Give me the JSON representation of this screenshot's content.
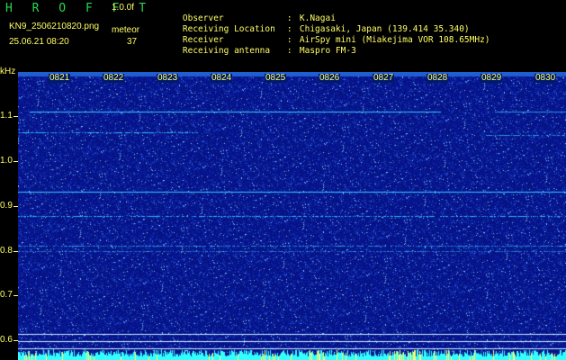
{
  "header": {
    "logo": "H R O F F T",
    "version": "1.0.0f",
    "filename": "KN9_2506210820.png",
    "datetime": "25.06.21 08:20",
    "counter_label": "meteor",
    "counter_value": "37"
  },
  "meta": [
    {
      "key": "Observer",
      "sep": ":",
      "value": "K.Nagai"
    },
    {
      "key": "Receiving Location",
      "sep": ":",
      "value": "Chigasaki, Japan (139.414 35.340)"
    },
    {
      "key": "Receiver",
      "sep": ":",
      "value": "AirSpy mini (Miakejima VOR 108.65MHz)"
    },
    {
      "key": "Receiving antenna",
      "sep": ":",
      "value": "Maspro FM-3"
    }
  ],
  "axis": {
    "unit_label": "kHz",
    "y_ticks": [
      "1.1",
      "1.0",
      "0.9",
      "0.8",
      "0.7",
      "0.6"
    ],
    "time_ticks": [
      "0821",
      "0822",
      "0823",
      "0824",
      "0825",
      "0826",
      "0827",
      "0828",
      "0829",
      "0830"
    ]
  },
  "colors": {
    "background": "#000000",
    "noise": "#0a1e8c",
    "signal": "#33ccff",
    "text": "#ffff66",
    "logo": "#28d850"
  }
}
